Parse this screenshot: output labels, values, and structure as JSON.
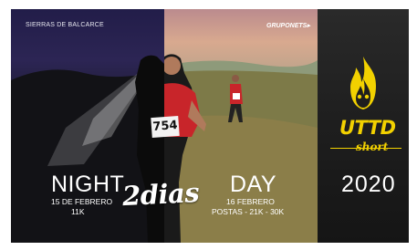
{
  "header": {
    "location": "SIERRAS DE BALCARCE",
    "sponsor": "GRUPONETS"
  },
  "night": {
    "title": "NIGHT",
    "date": "15 DE FEBRERO",
    "distance": "11K"
  },
  "middle": {
    "label": "2dias",
    "bib": "754"
  },
  "day": {
    "title": "DAY",
    "date": "16 FEBRERO",
    "distances": "POSTAS - 21K - 30K"
  },
  "brand": {
    "logo": "UTTD",
    "logo_sub": "short",
    "year": "2020",
    "accent_color": "#f2d100"
  },
  "icons": [
    "flame-icon"
  ]
}
